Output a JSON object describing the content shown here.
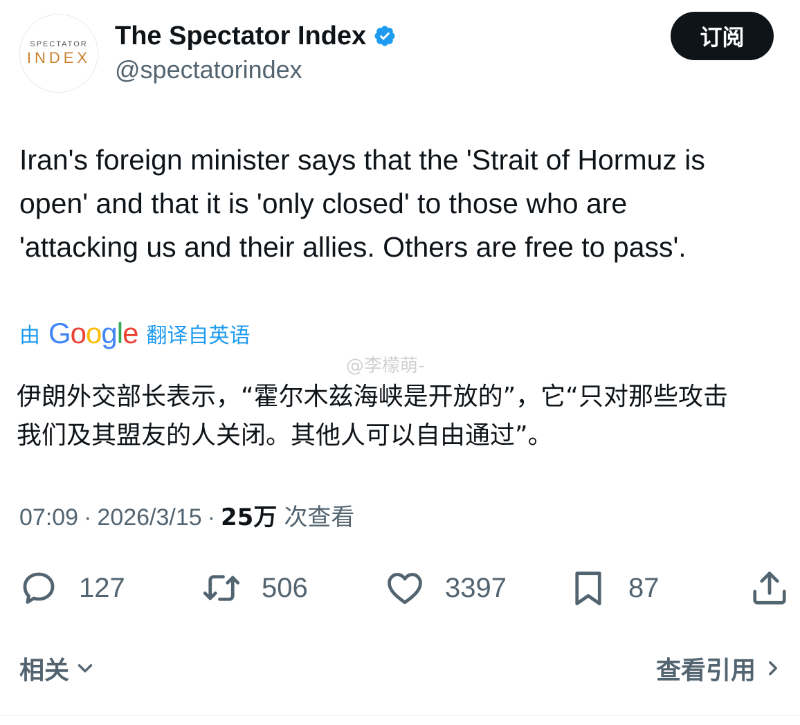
{
  "author": {
    "avatar_top": "SPECTATOR",
    "avatar_bottom": "INDEX",
    "display_name": "The Spectator Index",
    "handle": "@spectatorindex"
  },
  "subscribe_label": "订阅",
  "tweet_text": "Iran's foreign minister says that the 'Strait of Hormuz is\nopen' and that it is 'only closed' to those who are\n'attacking us and their allies. Others are free to pass'.",
  "translation": {
    "prefix": "由",
    "provider": "Google",
    "suffix": "翻译自英语",
    "text": "伊朗外交部长表示，“霍尔木兹海峡是开放的”，它“只对那些攻击\n我们及其盟友的人关闭。其他人可以自由通过”。"
  },
  "watermark": "@李檬萌-",
  "meta": {
    "time": "07:09",
    "sep1": "·",
    "date": "2026/3/15",
    "sep2": "·",
    "views": "25万",
    "views_label": "次查看"
  },
  "actions": {
    "replies": "127",
    "retweets": "506",
    "likes": "3397",
    "bookmarks": "87"
  },
  "footer": {
    "related": "相关",
    "view_quotes": "查看引用"
  },
  "colors": {
    "accent": "#1d9bf0",
    "text": "#0f1419",
    "muted": "#536471"
  }
}
